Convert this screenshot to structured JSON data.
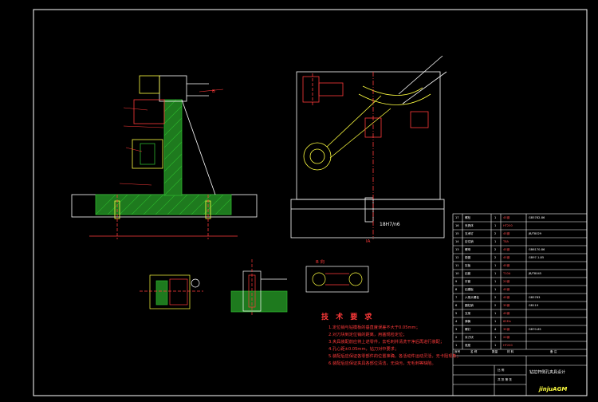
{
  "drawing": {
    "colors": {
      "background": "#000000",
      "outline": "#ffffff",
      "part_lines": "#ff3a3a",
      "hatch": "#2db52d",
      "accent": "#ffff40",
      "dimension": "#ffffff"
    },
    "views": {
      "section_view_label": "B 向",
      "side_marker": "B",
      "fit_tolerance": "18H7/n6",
      "section_mark": "IA"
    },
    "technical_requirements": {
      "title": "技 术 要 求",
      "notes": [
        "1.定位销与钻模板的垂直度误差不大于0.05mm；",
        "2.对刀块到定位销的距离，用塞规检定位；",
        "3.夹具装配前应将上述零件，去毛刺并清洗干净后再进行装配；",
        "4.孔心距±0.05mm，钻刀对中要求；",
        "5.装配后应保证各零部件的位置准确，各活动件运动灵活，无卡阻现象；",
        "6.装配后应保证夹具各部位清洁，无油污，无毛刺等缺陷。"
      ]
    },
    "title_block": {
      "bom_rows": [
        {
          "no": "17",
          "name": "螺栓",
          "qty": "1",
          "material": "45钢",
          "note": "GB5782-86"
        },
        {
          "no": "16",
          "name": "夹具体",
          "qty": "1",
          "material": "HT200",
          "note": ""
        },
        {
          "no": "15",
          "name": "支承钉",
          "qty": "2",
          "material": "45钢",
          "note": "JB/T8029"
        },
        {
          "no": "14",
          "name": "定位销",
          "qty": "1",
          "material": "T8A",
          "note": ""
        },
        {
          "no": "13",
          "name": "螺母",
          "qty": "2",
          "material": "45钢",
          "note": "GB6170-86"
        },
        {
          "no": "12",
          "name": "垫圈",
          "qty": "2",
          "material": "45钢",
          "note": "GB97.1-85"
        },
        {
          "no": "11",
          "name": "压板",
          "qty": "1",
          "material": "45钢",
          "note": ""
        },
        {
          "no": "10",
          "name": "钻套",
          "qty": "1",
          "material": "T10A",
          "note": "JB/T8045"
        },
        {
          "no": "9",
          "name": "衬套",
          "qty": "1",
          "material": "20钢",
          "note": ""
        },
        {
          "no": "8",
          "name": "钻模板",
          "qty": "1",
          "material": "45钢",
          "note": ""
        },
        {
          "no": "7",
          "name": "六角头螺栓",
          "qty": "2",
          "material": "45钢",
          "note": "GB5783"
        },
        {
          "no": "6",
          "name": "圆柱销",
          "qty": "2",
          "material": "35钢",
          "note": "GB119"
        },
        {
          "no": "5",
          "name": "支架",
          "qty": "1",
          "material": "45钢",
          "note": ""
        },
        {
          "no": "4",
          "name": "弹簧",
          "qty": "1",
          "material": "65Mn",
          "note": ""
        },
        {
          "no": "3",
          "name": "螺钉",
          "qty": "4",
          "material": "35钢",
          "note": "GB70-85"
        },
        {
          "no": "2",
          "name": "对刀块",
          "qty": "1",
          "material": "20钢",
          "note": ""
        },
        {
          "no": "1",
          "name": "底座",
          "qty": "1",
          "material": "HT200",
          "note": ""
        }
      ],
      "header": {
        "no": "序号",
        "name": "名 称",
        "qty": "数量",
        "material": "材 料",
        "note": "备 注"
      },
      "design_title": "钻拉杆侧孔夹具设计",
      "scale_label": "比 例",
      "sheet_label": "共 张 第 张",
      "logo": "jinjuAGM"
    }
  }
}
